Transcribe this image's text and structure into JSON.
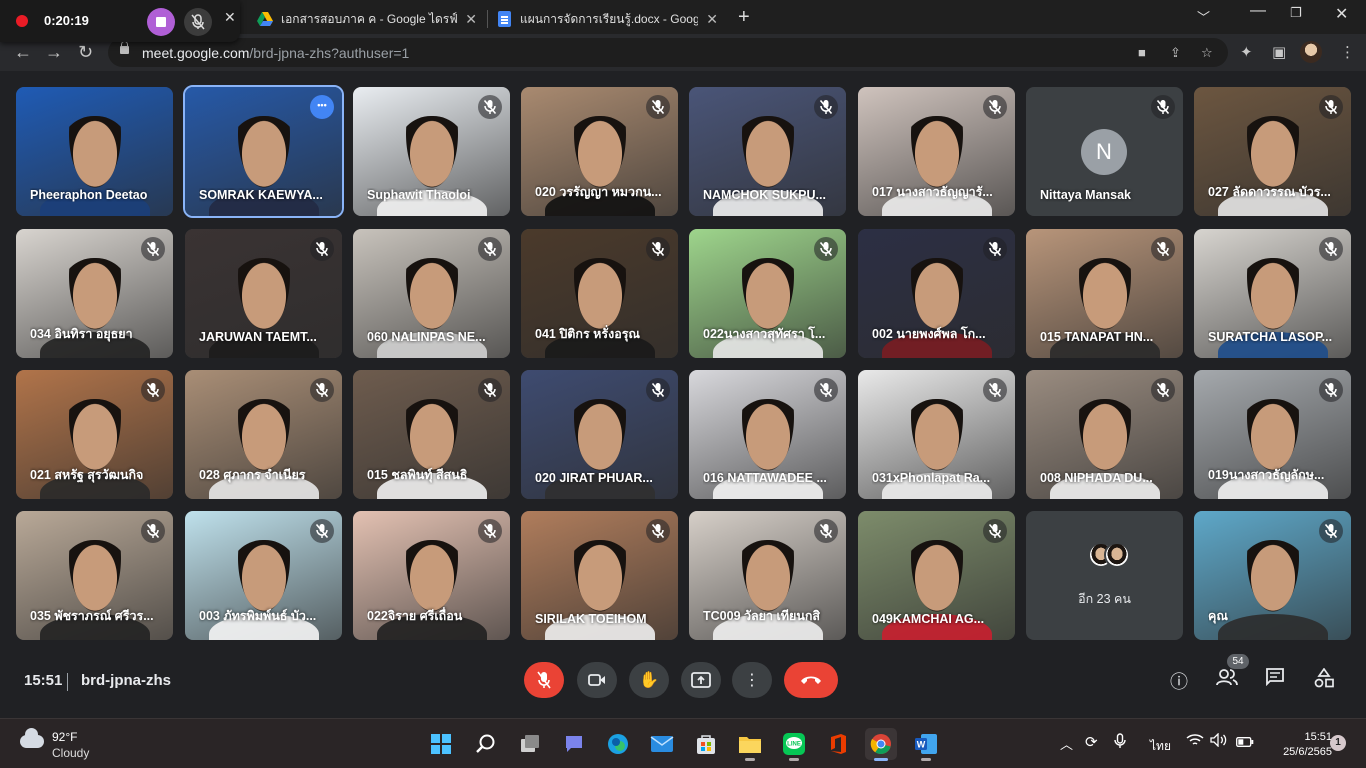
{
  "recording": {
    "time": "0:20:19"
  },
  "browser": {
    "tabs": [
      {
        "label": "เอกสารสอบภาค ค - Google ไดรฟ์",
        "icon": "google-drive-icon"
      },
      {
        "label": "แผนการจัดการเรียนรู้.docx - Google",
        "icon": "google-docs-icon"
      }
    ],
    "url_host": "meet.google.com",
    "url_path": "/brd-jpna-zhs?authuser=1"
  },
  "meet": {
    "participants": [
      {
        "name": "Pheeraphon Deetao",
        "muted": false,
        "bg": "#1f5bb5",
        "shirt": "#1c3f7a"
      },
      {
        "name": "SOMRAK KAEWYA...",
        "muted": false,
        "bg": "#2659a8",
        "shirt": "#222a44",
        "more": true,
        "active": true
      },
      {
        "name": "Suphawit Thaoloi",
        "muted": true,
        "bg": "#e9edf1",
        "shirt": "#f2f2f2"
      },
      {
        "name": "020 วรรัญญา หมวกน...",
        "muted": true,
        "bg": "#a98a70",
        "shirt": "#111111"
      },
      {
        "name": "NAMCHOK SUKPU...",
        "muted": true,
        "bg": "#4a5578",
        "shirt": "#f0f0f0"
      },
      {
        "name": "017 นางสาวธัญญารั...",
        "muted": true,
        "bg": "#cfc3bd",
        "shirt": "#ececec"
      },
      {
        "name": "Nittaya Mansak",
        "muted": true,
        "avatar": "N"
      },
      {
        "name": "027 ลัดดาวรรณ บัวร...",
        "muted": true,
        "bg": "#6c5640",
        "shirt": "#e6e6e6"
      },
      {
        "name": "034 อินทิรา อยุธยา",
        "muted": true,
        "bg": "#d8d4cf",
        "shirt": "#222222"
      },
      {
        "name": "JARUWAN TAEMT...",
        "muted": true,
        "bg": "#3a3333",
        "shirt": "#1c1c1c"
      },
      {
        "name": "060 NALINPAS NE...",
        "muted": true,
        "bg": "#c8c3bc",
        "shirt": "#d0d0d0"
      },
      {
        "name": "041 ปิติกร หรั่งอรุณ",
        "muted": true,
        "bg": "#4b3a2b",
        "shirt": "#1a1a1a"
      },
      {
        "name": "022นางสาวสุทัศรา โ...",
        "muted": true,
        "bg": "#9ed58c",
        "shirt": "#e8e8e8"
      },
      {
        "name": "002 นายพงศ์พล โก...",
        "muted": true,
        "bg": "#2c2f44",
        "shirt": "#7a1d22"
      },
      {
        "name": "015 TANAPAT HN...",
        "muted": true,
        "bg": "#b8957a",
        "shirt": "#2a2a2a"
      },
      {
        "name": "SURATCHA LASOP...",
        "muted": true,
        "bg": "#d7d4cf",
        "shirt": "#1d4d8c"
      },
      {
        "name": "021 สหรัฐ สุรวัฒนกิจ",
        "muted": true,
        "bg": "#b1744a",
        "shirt": "#2a2a2a"
      },
      {
        "name": "028 ศุภากร จำเนียร",
        "muted": true,
        "bg": "#a98e76",
        "shirt": "#e8e8e8"
      },
      {
        "name": "015 ชลพินทุ์ สีสนธิ",
        "muted": true,
        "bg": "#6e5c4e",
        "shirt": "#f1f1f1"
      },
      {
        "name": "020 JIRAT PHUAR...",
        "muted": true,
        "bg": "#3e4b70",
        "shirt": "#303030"
      },
      {
        "name": "016 NATTAWADEE ...",
        "muted": true,
        "bg": "#d8d8dc",
        "shirt": "#f3f3f3"
      },
      {
        "name": "031xPhonlapat Ra...",
        "muted": true,
        "bg": "#e9e9e9",
        "shirt": "#ededed"
      },
      {
        "name": "008 NIPHADA DU...",
        "muted": true,
        "bg": "#9a8c80",
        "shirt": "#f0f0f0"
      },
      {
        "name": "019นางสาวธัญลักษ...",
        "muted": true,
        "bg": "#a5a9ad",
        "shirt": "#f2f2f2"
      },
      {
        "name": "035 พัชราภรณ์ ศรีวร...",
        "muted": true,
        "bg": "#b9a998",
        "shirt": "#222222"
      },
      {
        "name": "003 ภัทรพิมพ์นธ์ บัว...",
        "muted": true,
        "bg": "#bfe1ec",
        "shirt": "#f5f5f5"
      },
      {
        "name": "022จิราย ศรีเถื่อน",
        "muted": true,
        "bg": "#e3c1b2",
        "shirt": "#202020"
      },
      {
        "name": "SIRILAK TOEIHOM",
        "muted": true,
        "bg": "#b07d5c",
        "shirt": "#f0f0f0"
      },
      {
        "name": "TC009 วัลยา เทียนกสิ",
        "muted": true,
        "bg": "#d6cfc8",
        "shirt": "#efefef"
      },
      {
        "name": "049KAMCHAI AG...",
        "muted": true,
        "bg": "#7d8c6b",
        "shirt": "#c91f2f"
      },
      {
        "name": "อีก 23 คน",
        "more_tile": true
      },
      {
        "name": "คุณ",
        "muted": true,
        "bg": "#5ea8c9",
        "shirt": "#2c2c2c"
      }
    ],
    "meeting_time": "15:51",
    "meeting_code": "brd-jpna-zhs",
    "participant_count": "54"
  },
  "taskbar": {
    "temperature": "92°F",
    "condition": "Cloudy",
    "language": "ไทย",
    "time": "15:51",
    "date": "25/6/2565",
    "notifications": "1"
  },
  "colors": {
    "accent": "#8ab4f8",
    "end_call": "#ea4335",
    "meet_bg": "#202124"
  }
}
